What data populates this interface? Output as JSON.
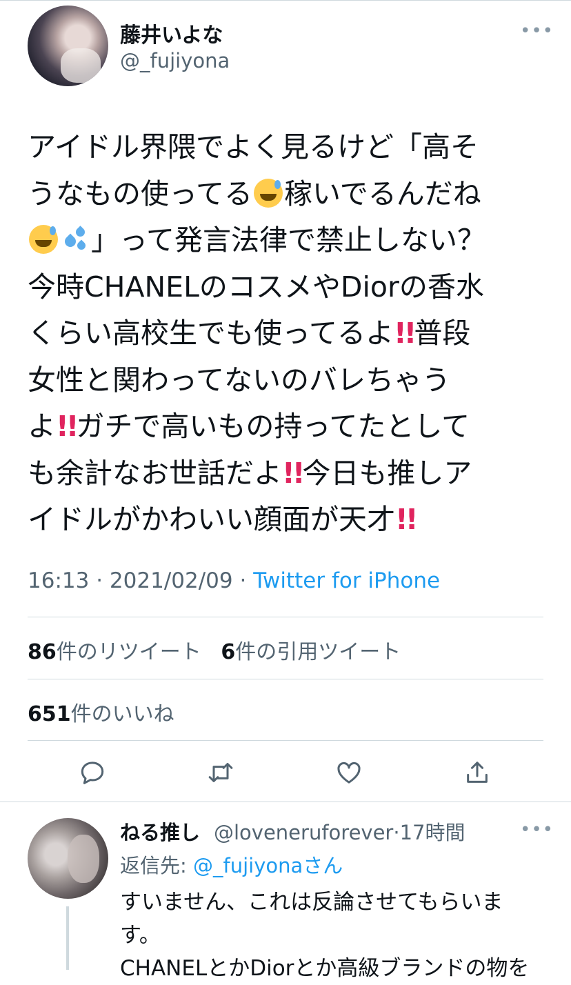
{
  "tweet": {
    "author_name": "藤井いよな",
    "author_handle": "@_fujiyona",
    "more_label": "•••",
    "lines": [
      [
        "アイドル界隈でよく見るけど「高そ"
      ],
      [
        "うなもの使ってる",
        "{sweat}",
        "稼いでるんだね"
      ],
      [
        "{sweat}",
        "{drops}",
        "」って発言法律で禁止しない？"
      ],
      [
        "今時CHANELのコスメやDiorの香水"
      ],
      [
        "くらい高校生でも使ってるよ",
        "{bang}",
        "普段"
      ],
      [
        "女性と関わってないのバレちゃう"
      ],
      [
        "よ",
        "{bang}",
        "ガチで高いもの持ってたとして"
      ],
      [
        "も余計なお世話だよ",
        "{bang}",
        "今日も推しア"
      ],
      [
        "イドルがかわいい顔面が天才",
        "{bang}"
      ]
    ],
    "bang_glyph": "!!",
    "time": "16:13",
    "date": "2021/02/09",
    "separator": "·",
    "source": "Twitter for iPhone"
  },
  "stats": {
    "retweets_count": "86",
    "retweets_label": "件のリツイート",
    "quotes_count": "6",
    "quotes_label": "件の引用ツイート",
    "likes_count": "651",
    "likes_label": "件のいいね"
  },
  "actions": [
    {
      "name": "reply-icon"
    },
    {
      "name": "retweet-icon"
    },
    {
      "name": "like-icon"
    },
    {
      "name": "share-icon"
    }
  ],
  "reply": {
    "author_name": "ねる推し",
    "author_handle": "@loveneruforever",
    "time_ago": "17時間",
    "separator": "·",
    "more_label": "•••",
    "reply_to_label": "返信先:",
    "reply_to_mention": "@_fujiyona",
    "reply_to_suffix": "さん",
    "lines": [
      "すいません、これは反論させてもらいま",
      "す。",
      "CHANELとかDiorとか高級ブランドの物を"
    ]
  },
  "colors": {
    "text": "#0f1419",
    "secondary": "#536471",
    "link": "#1d9bf0",
    "divider": "#cfd9de",
    "bang": "#e0245e"
  }
}
